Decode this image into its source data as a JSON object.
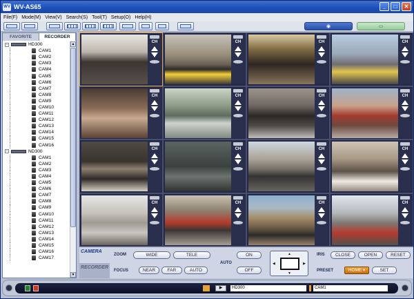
{
  "window": {
    "title": "WV-AS65"
  },
  "menu": [
    "File(F)",
    "Mode(M)",
    "View(V)",
    "Search(S)",
    "Tool(T)",
    "Setup(O)",
    "Help(H)"
  ],
  "tabs": {
    "favorite": "FAVORITE",
    "recorder": "RECORDER"
  },
  "tree": {
    "recorders": [
      {
        "name": "HD300",
        "cams": [
          "CAM1",
          "CAM2",
          "CAM3",
          "CAM4",
          "CAM5",
          "CAM6",
          "CAM7",
          "CAM8",
          "CAM9",
          "CAM10",
          "CAM11",
          "CAM12",
          "CAM13",
          "CAM14",
          "CAM15",
          "CAM16"
        ]
      },
      {
        "name": "ND300",
        "cams": [
          "CAM1",
          "CAM2",
          "CAM3",
          "CAM4",
          "CAM5",
          "CAM6",
          "CAM7",
          "CAM8",
          "CAM9",
          "CAM10",
          "CAM11",
          "CAM12",
          "CAM13",
          "CAM14",
          "CAM15",
          "CAM16",
          "CAM17"
        ]
      }
    ]
  },
  "cells": {
    "ch_label": "CH"
  },
  "panel": {
    "camera_tab": "CAMERA",
    "recorder_tab": "RECORDER",
    "zoom_label": "ZOOM",
    "focus_label": "FOCUS",
    "auto_label": "AUTO",
    "iris_label": "IRIS",
    "preset_label": "PRESET",
    "wide": "WIDE",
    "tele": "TELE",
    "near": "NEAR",
    "far": "FAR",
    "auto": "AUTO",
    "on": "ON",
    "off": "OFF",
    "close": "CLOSE",
    "open": "OPEN",
    "reset": "RESET",
    "home": "HOME",
    "set": "SET"
  },
  "status": {
    "recorder": "HD300",
    "camera": "CAM1"
  },
  "colors": {
    "accent": "#e6a23c",
    "title": "#1d4fb8"
  }
}
